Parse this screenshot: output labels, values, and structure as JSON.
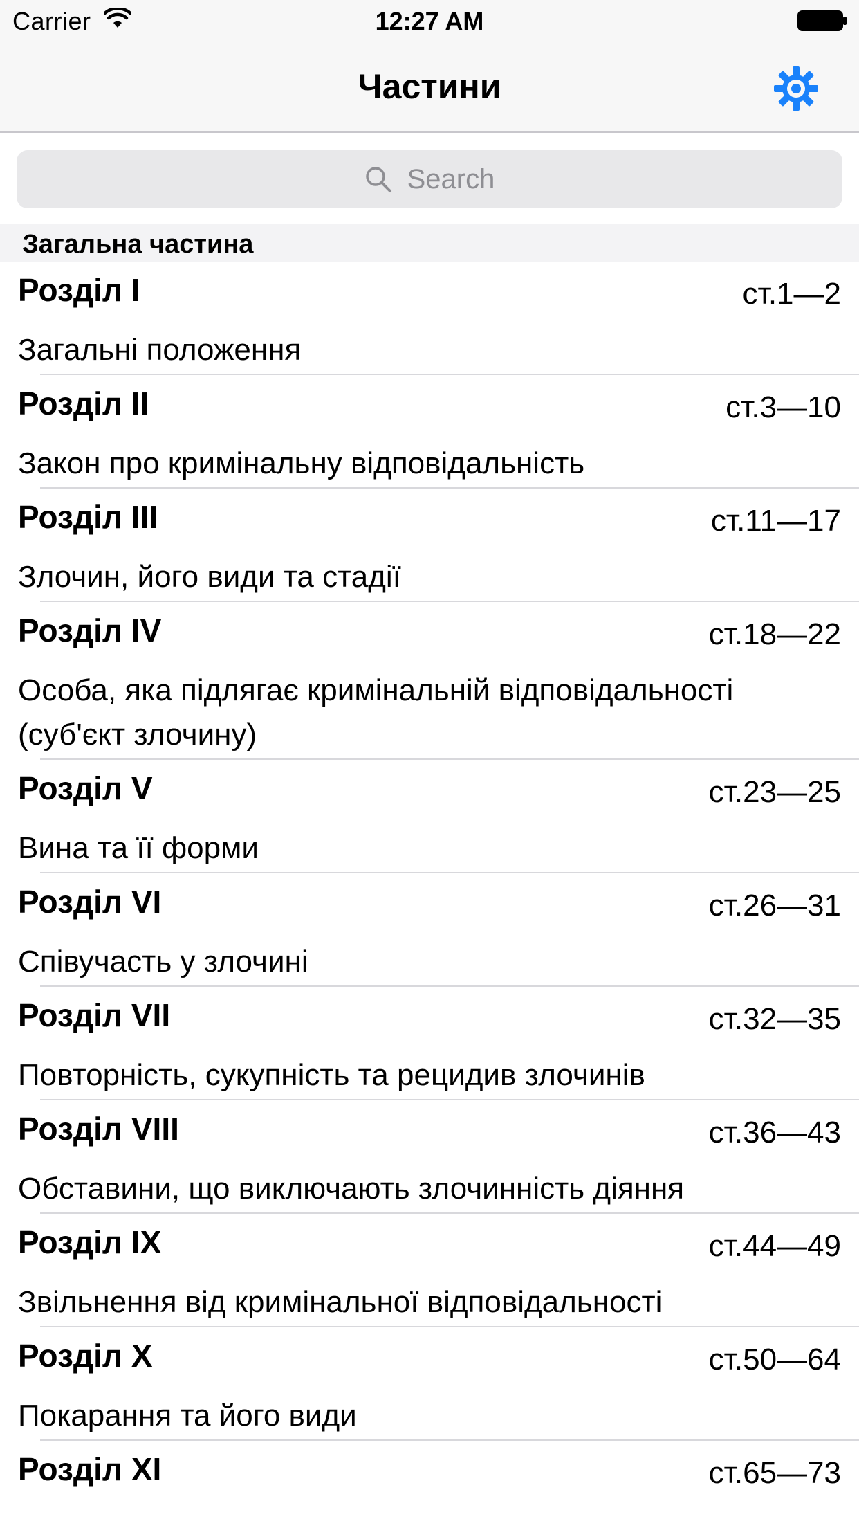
{
  "status_bar": {
    "carrier": "Carrier",
    "time": "12:27 AM"
  },
  "nav": {
    "title": "Частини",
    "settings_icon": "gear-icon"
  },
  "search": {
    "placeholder": "Search",
    "icon": "search-icon"
  },
  "section": {
    "header": "Загальна частина"
  },
  "rows": [
    {
      "title": "Розділ I",
      "range": "ст.1—2",
      "subtitle": "Загальні положення"
    },
    {
      "title": "Розділ II",
      "range": "ст.3—10",
      "subtitle": "Закон про кримінальну відповідальність"
    },
    {
      "title": "Розділ III",
      "range": "ст.11—17",
      "subtitle": "Злочин, його види та стадії"
    },
    {
      "title": "Розділ IV",
      "range": "ст.18—22",
      "subtitle": "Особа, яка підлягає кримінальній відповідальності (суб'єкт злочину)"
    },
    {
      "title": "Розділ V",
      "range": "ст.23—25",
      "subtitle": "Вина та її форми"
    },
    {
      "title": "Розділ VI",
      "range": "ст.26—31",
      "subtitle": "Співучасть у злочині"
    },
    {
      "title": "Розділ VII",
      "range": "ст.32—35",
      "subtitle": "Повторність, сукупність та рецидив злочинів"
    },
    {
      "title": "Розділ VIII",
      "range": "ст.36—43",
      "subtitle": "Обставини, що виключають злочинність діяння"
    },
    {
      "title": "Розділ IX",
      "range": "ст.44—49",
      "subtitle": "Звільнення від кримінальної відповідальності"
    },
    {
      "title": "Розділ X",
      "range": "ст.50—64",
      "subtitle": "Покарання та його види"
    },
    {
      "title": "Розділ XI",
      "range": "ст.65—73",
      "subtitle": ""
    }
  ],
  "colors": {
    "accent": "#1a82fb",
    "nav_background": "#f7f7f7",
    "search_background": "#e8e8ea",
    "section_background": "#f3f3f5",
    "separator": "#d8d8dc"
  }
}
